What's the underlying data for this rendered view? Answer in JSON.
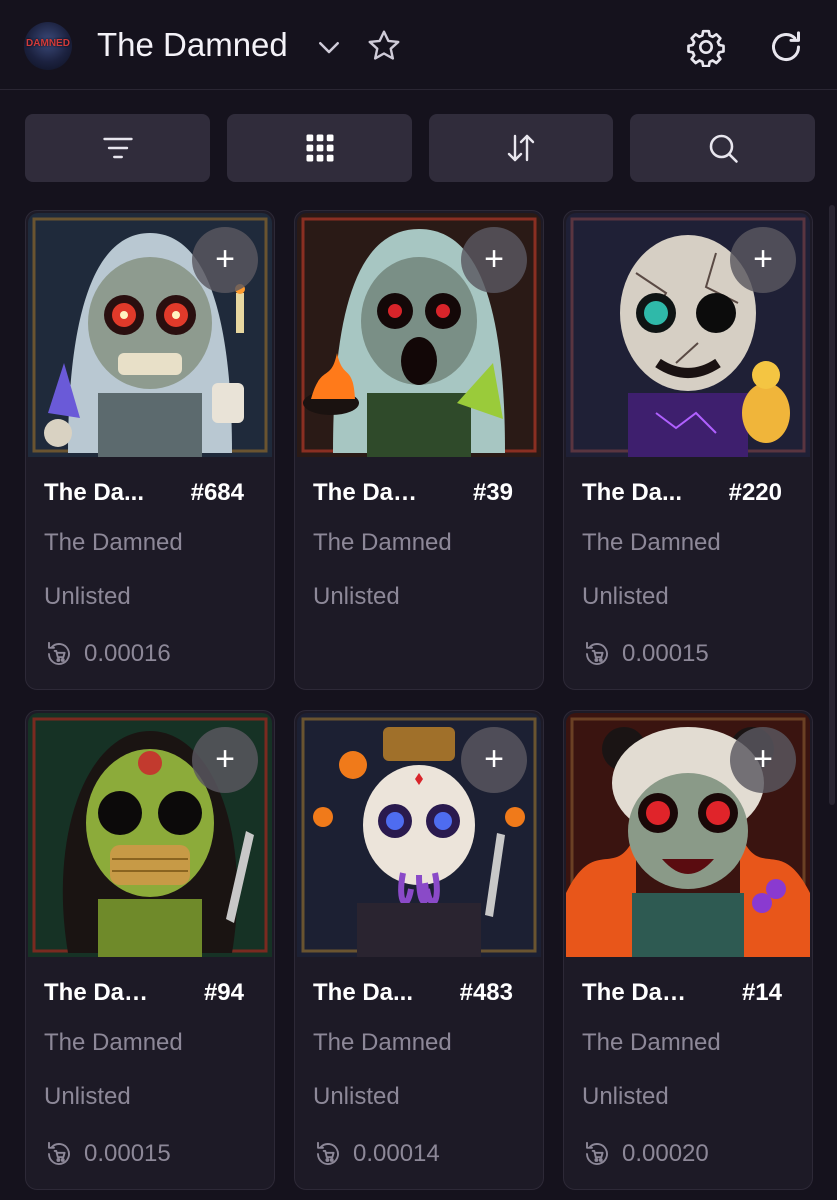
{
  "header": {
    "logo_text": "DAMNED",
    "title": "The Damned",
    "icons": [
      "chevron-down-icon",
      "star-icon",
      "gear-icon",
      "refresh-icon"
    ]
  },
  "toolbar": {
    "buttons": [
      "filter-icon",
      "grid-icon",
      "sort-icon",
      "search-icon"
    ]
  },
  "add_label": "+",
  "cards": [
    {
      "name": "The Da...",
      "number": "#684",
      "collection": "The Damned",
      "status": "Unlisted",
      "price": "0.00016"
    },
    {
      "name": "The Dam...",
      "number": "#39",
      "collection": "The Damned",
      "status": "Unlisted",
      "price": ""
    },
    {
      "name": "The Da...",
      "number": "#220",
      "collection": "The Damned",
      "status": "Unlisted",
      "price": "0.00015"
    },
    {
      "name": "The Dam...",
      "number": "#94",
      "collection": "The Damned",
      "status": "Unlisted",
      "price": "0.00015"
    },
    {
      "name": "The Da...",
      "number": "#483",
      "collection": "The Damned",
      "status": "Unlisted",
      "price": "0.00014"
    },
    {
      "name": "The Dam...",
      "number": "#14",
      "collection": "The Damned",
      "status": "Unlisted",
      "price": "0.00020"
    }
  ],
  "colors": {
    "background": "#15121d",
    "card": "#1d1a26",
    "toolbar_button": "#302c3b",
    "muted_text": "#8d8898"
  }
}
